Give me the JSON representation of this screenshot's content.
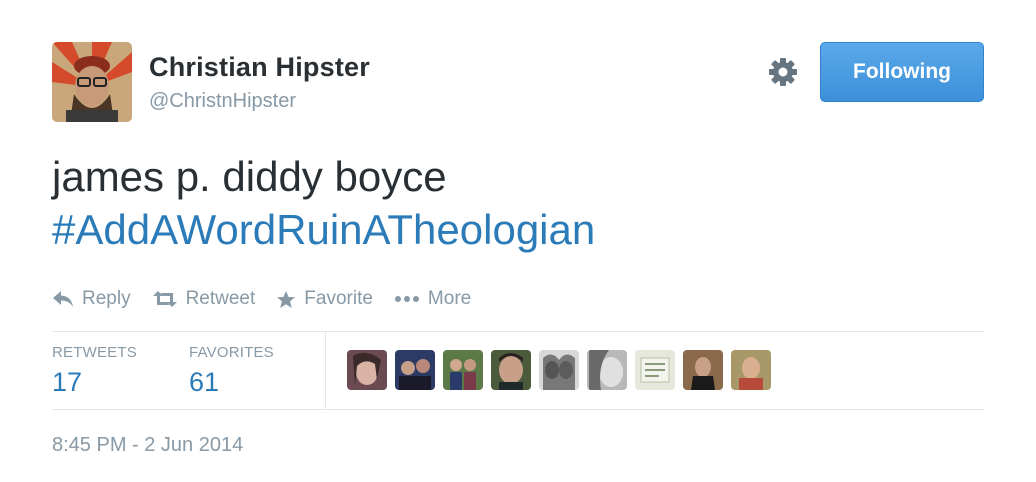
{
  "user": {
    "display_name": "Christian Hipster",
    "handle": "@ChristnHipster"
  },
  "follow_button": {
    "label": "Following"
  },
  "tweet": {
    "text_line1": "james p. diddy boyce",
    "hashtag": "#AddAWordRuinATheologian"
  },
  "actions": {
    "reply": "Reply",
    "retweet": "Retweet",
    "favorite": "Favorite",
    "more": "More"
  },
  "stats": {
    "retweets_label": "RETWEETS",
    "retweets_value": "17",
    "favorites_label": "FAVORITES",
    "favorites_value": "61"
  },
  "timestamp": "8:45 PM - 2 Jun 2014",
  "colors": {
    "link": "#2b7bb9",
    "follow_button_bg": "#4a9ee6",
    "meta_text": "#8899a6"
  },
  "icons": [
    "gear-icon",
    "reply-icon",
    "retweet-icon",
    "favorite-star-icon",
    "more-dots-icon"
  ]
}
